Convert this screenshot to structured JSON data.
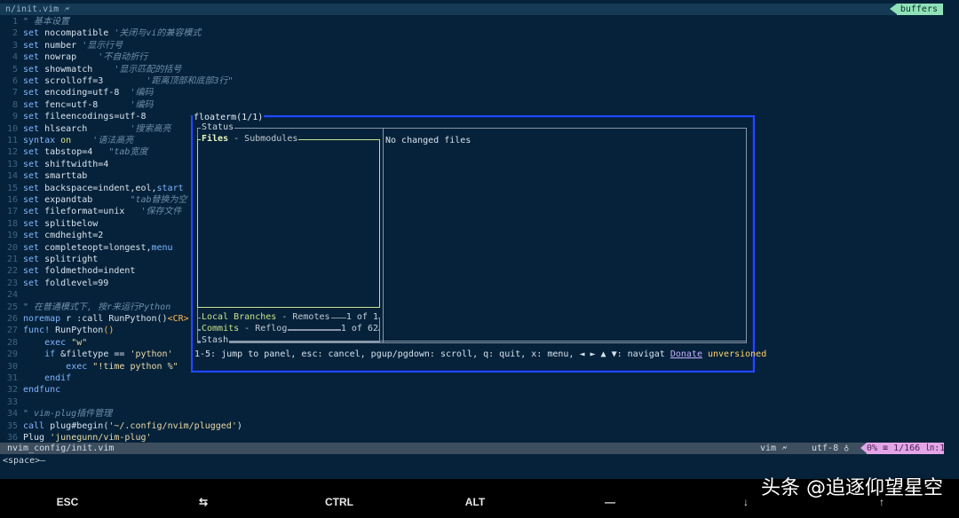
{
  "tabline": {
    "title": "n/init.vim 🗲",
    "buffers_label": "buffers"
  },
  "code_lines": [
    {
      "n": "1",
      "parts": [
        {
          "t": "\" 基本设置",
          "c": "cm"
        }
      ]
    },
    {
      "n": "2",
      "parts": [
        {
          "t": "set",
          "c": "kw"
        },
        {
          "t": " nocompatible "
        },
        {
          "t": "'关闭与vi的兼容模式",
          "c": "cm"
        }
      ]
    },
    {
      "n": "3",
      "parts": [
        {
          "t": "set",
          "c": "kw"
        },
        {
          "t": " number "
        },
        {
          "t": "'显示行号",
          "c": "cm"
        }
      ]
    },
    {
      "n": "4",
      "parts": [
        {
          "t": "set",
          "c": "kw"
        },
        {
          "t": " nowrap    "
        },
        {
          "t": "'不自动折行",
          "c": "cm"
        }
      ]
    },
    {
      "n": "5",
      "parts": [
        {
          "t": "set",
          "c": "kw"
        },
        {
          "t": " showmatch    "
        },
        {
          "t": "'显示匹配的括号",
          "c": "cm"
        }
      ]
    },
    {
      "n": "6",
      "parts": [
        {
          "t": "set",
          "c": "kw"
        },
        {
          "t": " scrolloff=3        "
        },
        {
          "t": "'距离顶部和底部3行\"",
          "c": "cm"
        }
      ]
    },
    {
      "n": "7",
      "parts": [
        {
          "t": "set",
          "c": "kw"
        },
        {
          "t": " encoding=utf-8  "
        },
        {
          "t": "'编码",
          "c": "cm"
        }
      ]
    },
    {
      "n": "8",
      "parts": [
        {
          "t": "set",
          "c": "kw"
        },
        {
          "t": " fenc=utf-8      "
        },
        {
          "t": "'编码",
          "c": "cm"
        }
      ]
    },
    {
      "n": "9",
      "parts": [
        {
          "t": "set",
          "c": "kw"
        },
        {
          "t": " fileencodings=utf-8"
        }
      ]
    },
    {
      "n": "10",
      "parts": [
        {
          "t": "set",
          "c": "kw"
        },
        {
          "t": " hlsearch        "
        },
        {
          "t": "'搜索高亮",
          "c": "cm"
        }
      ]
    },
    {
      "n": "11",
      "parts": [
        {
          "t": "syntax",
          "c": "kw"
        },
        {
          "t": " "
        },
        {
          "t": "on",
          "c": "on"
        },
        {
          "t": "    "
        },
        {
          "t": "'语法高亮",
          "c": "cm"
        }
      ]
    },
    {
      "n": "12",
      "parts": [
        {
          "t": "set",
          "c": "kw"
        },
        {
          "t": " tabstop=4   "
        },
        {
          "t": "\"tab宽度",
          "c": "cm"
        }
      ]
    },
    {
      "n": "13",
      "parts": [
        {
          "t": "set",
          "c": "kw"
        },
        {
          "t": " shiftwidth=4"
        }
      ]
    },
    {
      "n": "14",
      "parts": [
        {
          "t": "set",
          "c": "kw"
        },
        {
          "t": " smarttab"
        }
      ]
    },
    {
      "n": "15",
      "parts": [
        {
          "t": "set",
          "c": "kw"
        },
        {
          "t": " backspace=indent,eol,"
        },
        {
          "t": "start",
          "c": "kw"
        }
      ]
    },
    {
      "n": "16",
      "parts": [
        {
          "t": "set",
          "c": "kw"
        },
        {
          "t": " expandtab       "
        },
        {
          "t": "\"tab替换为空",
          "c": "cm"
        }
      ]
    },
    {
      "n": "17",
      "parts": [
        {
          "t": "set",
          "c": "kw"
        },
        {
          "t": " fileformat=unix   "
        },
        {
          "t": "'保存文件",
          "c": "cm"
        }
      ]
    },
    {
      "n": "18",
      "parts": [
        {
          "t": "set",
          "c": "kw"
        },
        {
          "t": " splitbelow"
        }
      ]
    },
    {
      "n": "19",
      "parts": [
        {
          "t": "set",
          "c": "kw"
        },
        {
          "t": " cmdheight=2"
        }
      ]
    },
    {
      "n": "20",
      "parts": [
        {
          "t": "set",
          "c": "kw"
        },
        {
          "t": " completeopt=longest,"
        },
        {
          "t": "menu",
          "c": "kw"
        }
      ]
    },
    {
      "n": "21",
      "parts": [
        {
          "t": "set",
          "c": "kw"
        },
        {
          "t": " splitright"
        }
      ]
    },
    {
      "n": "22",
      "parts": [
        {
          "t": "set",
          "c": "kw"
        },
        {
          "t": " foldmethod=indent"
        }
      ]
    },
    {
      "n": "23",
      "parts": [
        {
          "t": "set",
          "c": "kw"
        },
        {
          "t": " foldlevel=99"
        }
      ]
    },
    {
      "n": "24",
      "parts": []
    },
    {
      "n": "25",
      "parts": [
        {
          "t": "\" 在普通模式下, 按r来运行Python",
          "c": "cm"
        }
      ]
    },
    {
      "n": "26",
      "parts": [
        {
          "t": "noremap",
          "c": "kw"
        },
        {
          "t": " r :call RunPython()"
        },
        {
          "t": "<CR>",
          "c": "cr"
        }
      ]
    },
    {
      "n": "27",
      "parts": [
        {
          "t": "func!",
          "c": "kw"
        },
        {
          "t": " RunPython"
        },
        {
          "t": "()",
          "c": "cr"
        }
      ]
    },
    {
      "n": "28",
      "parts": [
        {
          "t": "    "
        },
        {
          "t": "exec",
          "c": "kw"
        },
        {
          "t": " "
        },
        {
          "t": "\"w\"",
          "c": "str"
        }
      ]
    },
    {
      "n": "29",
      "parts": [
        {
          "t": "    "
        },
        {
          "t": "if",
          "c": "kw"
        },
        {
          "t": " &filetype == "
        },
        {
          "t": "'python'",
          "c": "str"
        }
      ]
    },
    {
      "n": "30",
      "parts": [
        {
          "t": "        "
        },
        {
          "t": "exec",
          "c": "kw"
        },
        {
          "t": " "
        },
        {
          "t": "\"!time python %\"",
          "c": "str"
        }
      ]
    },
    {
      "n": "31",
      "parts": [
        {
          "t": "    "
        },
        {
          "t": "endif",
          "c": "kw"
        }
      ]
    },
    {
      "n": "32",
      "parts": [
        {
          "t": "endfunc",
          "c": "kw"
        }
      ]
    },
    {
      "n": "33",
      "parts": []
    },
    {
      "n": "34",
      "parts": [
        {
          "t": "\" vim-plug插件管理",
          "c": "cm"
        }
      ]
    },
    {
      "n": "35",
      "parts": [
        {
          "t": "call",
          "c": "kw"
        },
        {
          "t": " plug#begin("
        },
        {
          "t": "'~/.config/nvim/plugged'",
          "c": "str"
        },
        {
          "t": ")"
        }
      ]
    },
    {
      "n": "36",
      "parts": [
        {
          "t": "Plug "
        },
        {
          "t": "'junegunn/vim-plug'",
          "c": "str"
        }
      ]
    }
  ],
  "floaterm": {
    "title": "floaterm(1/1)",
    "status_title": "Status",
    "files_title": "Files",
    "files_sub": " - Submodules",
    "branches_title": "Local Branches",
    "branches_sub": " - Remotes",
    "branches_count": "1 of 1",
    "commits_title": "Commits",
    "commits_sub": " - Reflog",
    "commits_count": "1 of 62",
    "stash_title": "Stash",
    "no_changes": "No changed files",
    "help": "1-5: jump to panel, esc: cancel, pgup/pgdown: scroll, q: quit, x: menu, ◄ ► ▲ ▼: navigat",
    "donate": "Donate",
    "unversioned": "unversioned"
  },
  "statusline": {
    "file": "nvim_config/init.vim",
    "filetype": "vim 🗲",
    "encoding": "utf-8 ♁",
    "position": "0% ≡ 1/166 ㏑:1"
  },
  "cmdline": "<space>—",
  "keybar": [
    "ESC",
    "⇆",
    "CTRL",
    "ALT",
    "—",
    "↓",
    "↑"
  ],
  "watermark": "头条 @追逐仰望星空",
  "colors": {
    "background": "#06223a",
    "float_border": "#1f4bff",
    "active_pane": "#c8e28c"
  }
}
